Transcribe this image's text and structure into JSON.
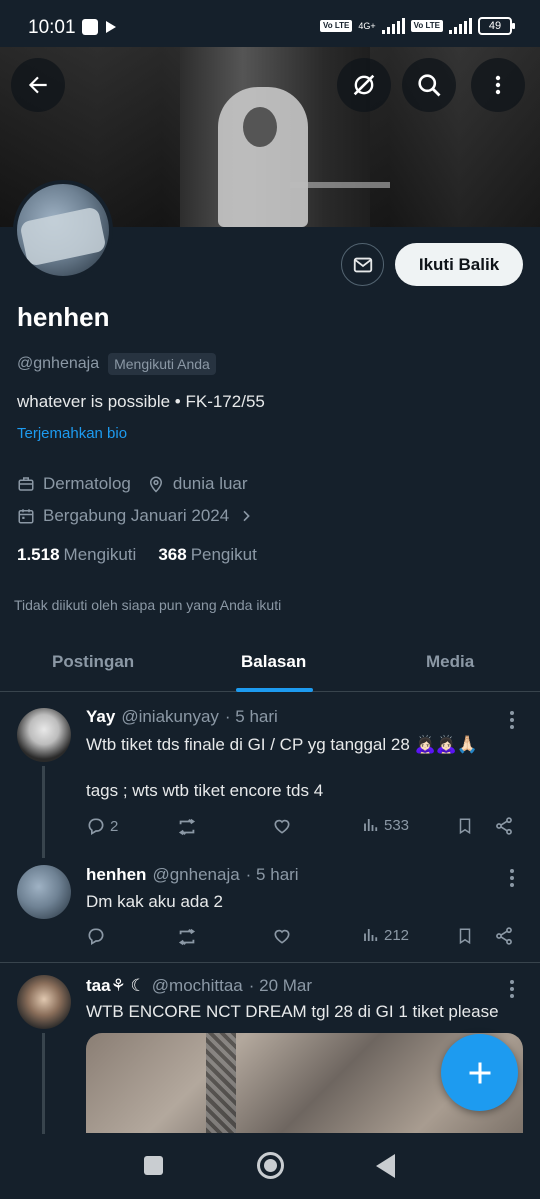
{
  "status_bar": {
    "time": "10:01",
    "net_label": "4G+",
    "volte_label_1": "Vo LTE",
    "volte_label_2": "Vo LTE",
    "battery": "49"
  },
  "header": {
    "back_icon": "arrow-left-icon",
    "grok_icon": "grok-icon",
    "search_icon": "search-icon",
    "more_icon": "more-vertical-icon"
  },
  "profile": {
    "name": "henhen",
    "handle": "@gnhenaja",
    "follows_you": "Mengikuti Anda",
    "bio": "whatever is possible • FK-172/55",
    "translate_bio": "Terjemahkan bio",
    "profession": "Dermatolog",
    "location": "dunia luar",
    "joined": "Bergabung Januari 2024",
    "following_count": "1.518",
    "following_label": "Mengikuti",
    "followers_count": "368",
    "followers_label": "Pengikut",
    "not_followed_note": "Tidak diikuti oleh siapa pun yang Anda ikuti",
    "follow_back_label": "Ikuti Balik"
  },
  "tabs": [
    {
      "label": "Postingan",
      "active": false
    },
    {
      "label": "Balasan",
      "active": true
    },
    {
      "label": "Media",
      "active": false
    }
  ],
  "tweets": [
    {
      "name": "Yay",
      "handle": "@iniakunyay",
      "time": "· 5 hari",
      "text_line1": "Wtb tiket tds finale di GI / CP yg tanggal 28 🙇🏻‍♀️🙇🏻‍♀️🙏🏻",
      "text_line2": "tags ; wts wtb tiket encore tds 4",
      "replies": "2",
      "views": "533"
    },
    {
      "name": "henhen",
      "handle": "@gnhenaja",
      "time": "· 5 hari",
      "text_line1": "Dm kak aku ada 2",
      "views": "212"
    },
    {
      "name": "taa⚘ ☾",
      "handle": "@mochittaa",
      "time": "· 20 Mar",
      "text_line1": "WTB ENCORE NCT DREAM tgl 28 di GI 1 tiket please"
    }
  ],
  "colors": {
    "background": "#15202b",
    "accent": "#1d9bf0",
    "muted": "#8b98a5",
    "divider": "#38444d"
  }
}
